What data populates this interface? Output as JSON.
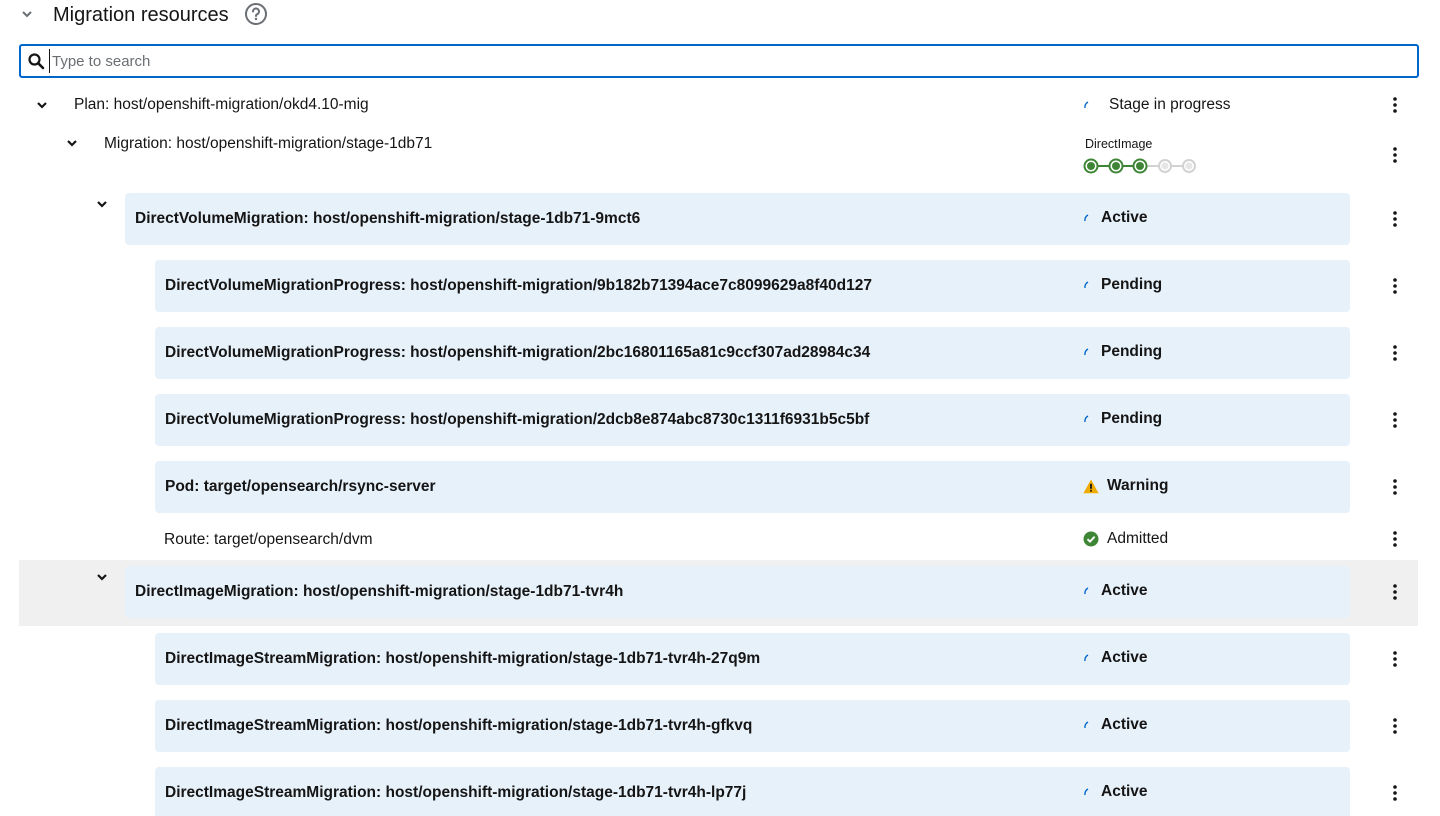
{
  "header": {
    "title": "Migration resources"
  },
  "search": {
    "placeholder": "Type to search",
    "value": ""
  },
  "plan": {
    "label": "Plan: host/openshift-migration/okd4.10-mig",
    "status": "Stage in progress"
  },
  "migration": {
    "label": "Migration: host/openshift-migration/stage-1db71",
    "pipeline_label": "DirectImage",
    "pipeline_steps": 5,
    "pipeline_completed": 3
  },
  "dvm": {
    "label": "DirectVolumeMigration: host/openshift-migration/stage-1db71-9mct6",
    "status": "Active"
  },
  "dvm_children": [
    {
      "label": "DirectVolumeMigrationProgress: host/openshift-migration/9b182b71394ace7c8099629a8f40d127",
      "status": "Pending"
    },
    {
      "label": "DirectVolumeMigrationProgress: host/openshift-migration/2bc16801165a81c9ccf307ad28984c34",
      "status": "Pending"
    },
    {
      "label": "DirectVolumeMigrationProgress: host/openshift-migration/2dcb8e874abc8730c1311f6931b5c5bf",
      "status": "Pending"
    },
    {
      "label": "Pod: target/opensearch/rsync-server",
      "status": "Warning"
    }
  ],
  "route": {
    "label": "Route: target/opensearch/dvm",
    "status": "Admitted"
  },
  "dim": {
    "label": "DirectImageMigration: host/openshift-migration/stage-1db71-tvr4h",
    "status": "Active"
  },
  "dism_children": [
    {
      "label": "DirectImageStreamMigration: host/openshift-migration/stage-1db71-tvr4h-27q9m",
      "status": "Active"
    },
    {
      "label": "DirectImageStreamMigration: host/openshift-migration/stage-1db71-tvr4h-gfkvq",
      "status": "Active"
    },
    {
      "label": "DirectImageStreamMigration: host/openshift-migration/stage-1db71-tvr4h-lp77j",
      "status": "Active"
    }
  ],
  "colors": {
    "accent": "#0066cc",
    "card": "#e7f1fa",
    "success": "#3e8635",
    "warning": "#f0ab00",
    "inactive": "#d2d2d2"
  },
  "icons": {
    "toggle": "chevron-down-icon",
    "help": "question-circle-icon",
    "search": "search-icon",
    "spinner": "spinner-icon",
    "warning": "warning-triangle-icon",
    "success": "check-circle-icon",
    "kebab": "kebab-icon"
  }
}
